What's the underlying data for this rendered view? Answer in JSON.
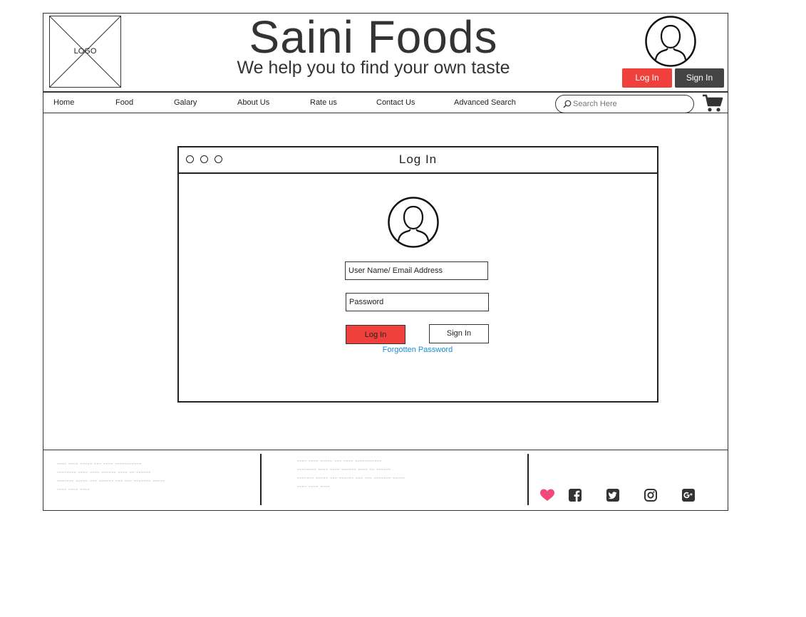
{
  "header": {
    "logo_label": "LOGO",
    "title": "Saini Foods",
    "tagline": "We help you to find your own taste",
    "login_label": "Log In",
    "signin_label": "Sign In"
  },
  "nav": {
    "items": [
      "Home",
      "Food",
      "Galary",
      "About Us",
      "Rate us",
      "Contact Us",
      "Advanced Search"
    ],
    "search_placeholder": "Search Here"
  },
  "login_window": {
    "title": "Log In",
    "username_placeholder": "User Name/ Email Address",
    "password_placeholder": "Password",
    "login_label": "Log In",
    "signin_label": "Sign In",
    "forgot_label": "Forgotten Password"
  },
  "footer": {
    "col1_lines": [
      "ᵕᵕᵕᵕ ᵕᵕᵕᵕ ᵕᵕᵕᵕᵕ ᵕᵕᵕ ᵕᵕᵕᵕ ᵕᵕᵕᵕᵕᵕᵕᵕᵕᵕᵕ",
      "ᵕᵕᵕᵕᵕᵕᵕᵕ ᵕᵕᵕᵕ ᵕᵕᵕᵕ ᵕᵕᵕᵕᵕᵕ ᵕᵕᵕᵕ ᵕᵕ ᵕᵕᵕᵕᵕᵕ",
      "ᵕᵕᵕᵕᵕᵕᵕ ᵕᵕᵕᵕᵕ ᵕᵕᵕ ᵕᵕᵕᵕᵕᵕ ᵕᵕᵕ ᵕᵕᵕ ᵕᵕᵕᵕᵕᵕᵕ ᵕᵕᵕᵕᵕ",
      "ᵕᵕᵕᵕ ᵕᵕᵕᵕ ᵕᵕᵕᵕ"
    ],
    "col2_lines": [
      "ᵕᵕᵕᵕ ᵕᵕᵕᵕ ᵕᵕᵕᵕᵕ ᵕᵕᵕ ᵕᵕᵕᵕ ᵕᵕᵕᵕᵕᵕᵕᵕᵕᵕᵕ",
      "ᵕᵕᵕᵕᵕᵕᵕᵕ ᵕᵕᵕᵕ ᵕᵕᵕᵕ ᵕᵕᵕᵕᵕᵕ ᵕᵕᵕᵕ ᵕᵕ ᵕᵕᵕᵕᵕᵕ",
      "ᵕᵕᵕᵕᵕᵕᵕ ᵕᵕᵕᵕᵕ ᵕᵕᵕ ᵕᵕᵕᵕᵕᵕ ᵕᵕᵕ ᵕᵕᵕ ᵕᵕᵕᵕᵕᵕᵕ ᵕᵕᵕᵕᵕ",
      "ᵕᵕᵕᵕ ᵕᵕᵕᵕ ᵕᵕᵕᵕ"
    ],
    "icons": [
      "heart-icon",
      "facebook-icon",
      "twitter-icon",
      "instagram-icon",
      "google-plus-icon"
    ]
  },
  "colors": {
    "accent_red": "#f0403c",
    "dark_button": "#444444",
    "link_blue": "#1a8cd8",
    "heart_pink": "#f2497a"
  }
}
